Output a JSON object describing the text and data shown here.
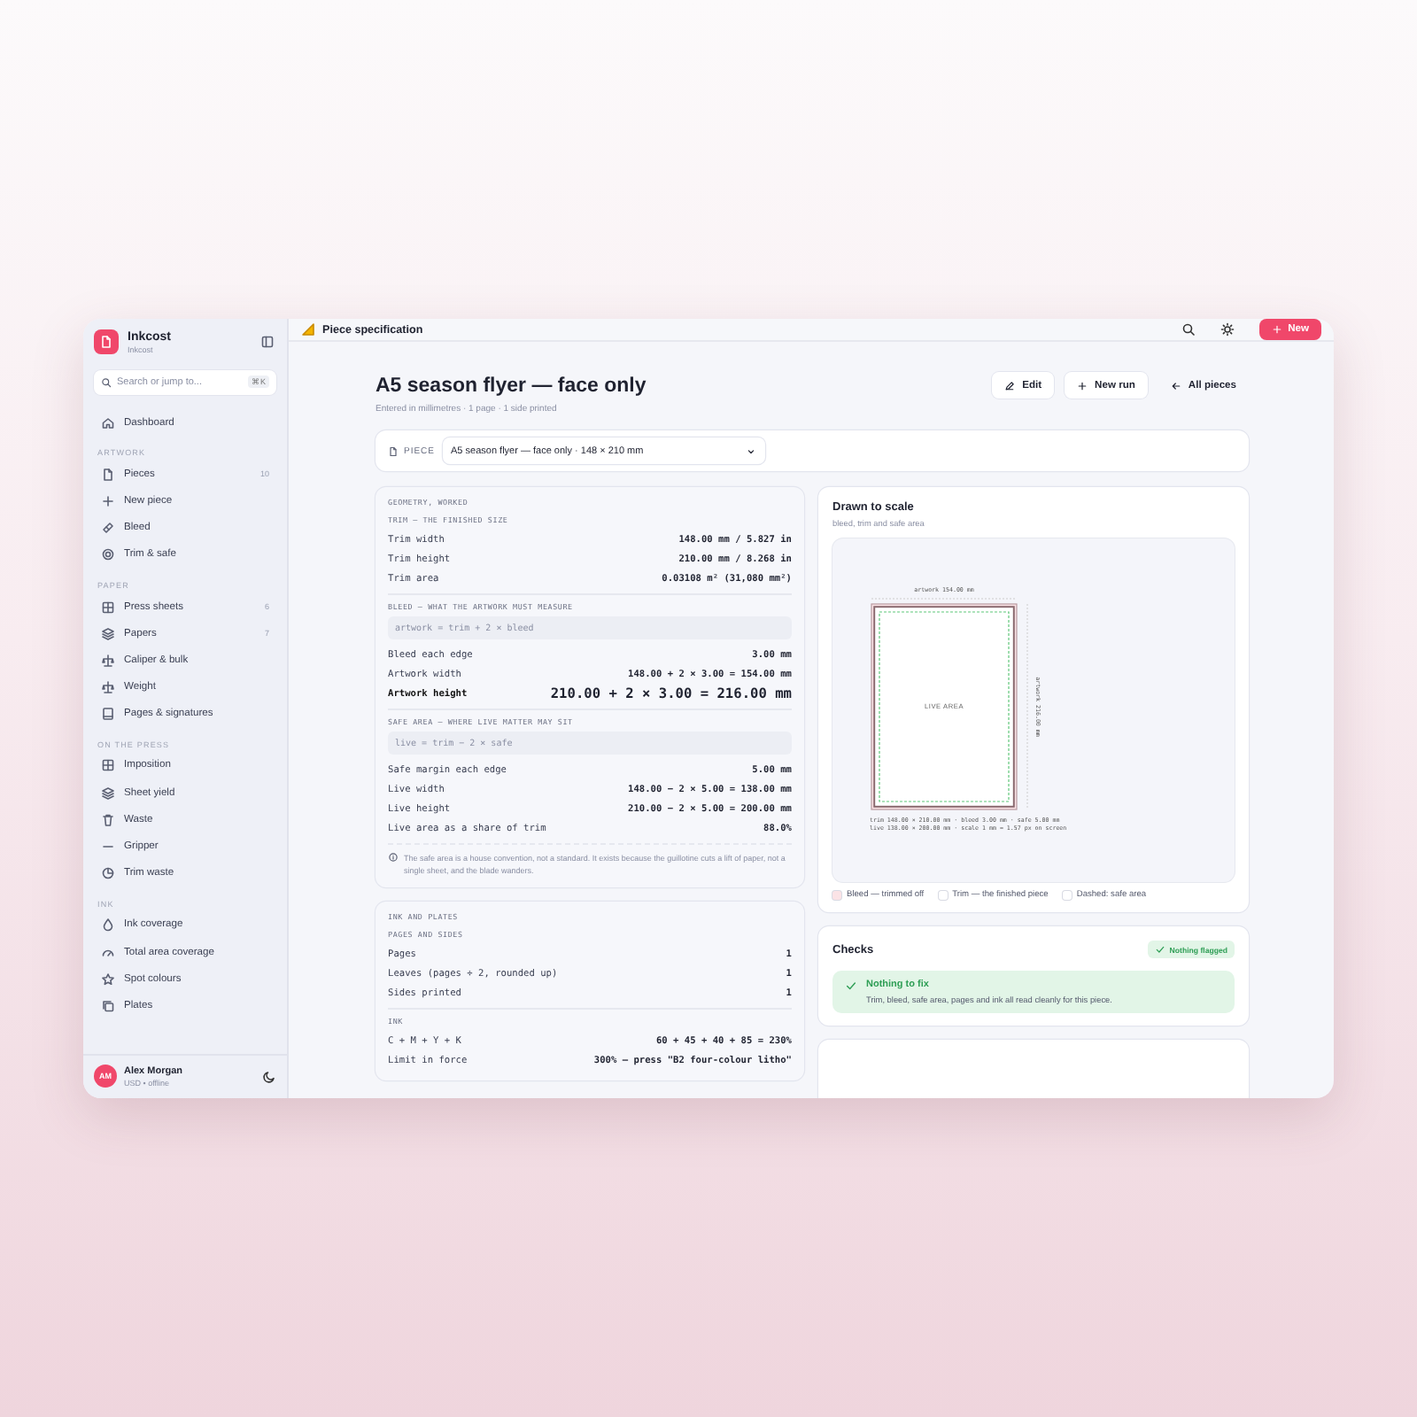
{
  "app": {
    "name": "Inkcost",
    "subtitle": "Inkcost"
  },
  "search": {
    "placeholder": "Search or jump to...",
    "shortcut": "⌘K"
  },
  "sidebar": {
    "top_items": [
      {
        "label": "Dashboard"
      }
    ],
    "sections": [
      {
        "title": "ARTWORK",
        "items": [
          {
            "label": "Pieces",
            "count": "10"
          },
          {
            "label": "New piece"
          },
          {
            "label": "Bleed"
          },
          {
            "label": "Trim & safe"
          }
        ]
      },
      {
        "title": "PAPER",
        "items": [
          {
            "label": "Press sheets",
            "count": "6"
          },
          {
            "label": "Papers",
            "count": "7"
          },
          {
            "label": "Caliper & bulk"
          },
          {
            "label": "Weight"
          },
          {
            "label": "Pages & signatures"
          }
        ]
      },
      {
        "title": "ON THE PRESS",
        "items": [
          {
            "label": "Imposition"
          },
          {
            "label": "Sheet yield"
          },
          {
            "label": "Waste"
          },
          {
            "label": "Gripper"
          },
          {
            "label": "Trim waste"
          }
        ]
      },
      {
        "title": "INK",
        "items": [
          {
            "label": "Ink coverage"
          },
          {
            "label": "Total area coverage"
          },
          {
            "label": "Spot colours"
          },
          {
            "label": "Plates"
          }
        ]
      }
    ]
  },
  "user": {
    "initials": "AM",
    "name": "Alex Morgan",
    "status": "USD • offline"
  },
  "topbar": {
    "title": "Piece specification",
    "new_button": "New"
  },
  "page": {
    "title": "A5 season flyer — face only",
    "subtitle": "Entered in millimetres · 1 page · 1 side printed",
    "actions": [
      "Edit",
      "New run",
      "All pieces"
    ]
  },
  "piece_selector": {
    "label": "PIECE",
    "value": "A5 season flyer — face only · 148 × 210 mm"
  },
  "geometry": {
    "heading": "GEOMETRY, WORKED",
    "sections": [
      {
        "title": "TRIM — THE FINISHED SIZE",
        "rows": [
          {
            "label": "Trim width",
            "value": "148.00 mm / 5.827 in",
            "emphasis": false
          },
          {
            "label": "Trim height",
            "value": "210.00 mm / 8.268 in",
            "emphasis": false
          },
          {
            "label": "Trim area",
            "value": "0.03108 m² (31,080 mm²)",
            "emphasis": false
          }
        ]
      },
      {
        "title": "BLEED — WHAT THE ARTWORK MUST MEASURE",
        "formula": "artwork = trim + 2 × bleed",
        "rows": [
          {
            "label": "Bleed each edge",
            "value": "3.00 mm",
            "emphasis": false
          },
          {
            "label": "Artwork width",
            "value": "148.00 + 2 × 3.00 = 154.00 mm",
            "emphasis": false
          },
          {
            "label": "Artwork height",
            "value": "210.00 + 2 × 3.00 = 216.00 mm",
            "emphasis": true
          }
        ]
      },
      {
        "title": "SAFE AREA — WHERE LIVE MATTER MAY SIT",
        "formula": "live = trim − 2 × safe",
        "rows": [
          {
            "label": "Safe margin each edge",
            "value": "5.00 mm",
            "emphasis": false
          },
          {
            "label": "Live width",
            "value": "148.00 − 2 × 5.00 = 138.00 mm",
            "emphasis": false
          },
          {
            "label": "Live height",
            "value": "210.00 − 2 × 5.00 = 200.00 mm",
            "emphasis": false
          },
          {
            "label": "Live area as a share of trim",
            "value": "88.0%",
            "emphasis": false
          }
        ]
      }
    ],
    "note": "The safe area is a house convention, not a standard. It exists because the guillotine cuts a lift of paper, not a single sheet, and the blade wanders."
  },
  "ink": {
    "heading": "INK AND PLATES",
    "sections": [
      {
        "title": "PAGES AND SIDES",
        "rows": [
          {
            "label": "Pages",
            "value": "1",
            "emphasis": false
          },
          {
            "label": "Leaves (pages ÷ 2, rounded up)",
            "value": "1",
            "emphasis": false
          },
          {
            "label": "Sides printed",
            "value": "1",
            "emphasis": false
          }
        ]
      },
      {
        "title": "INK",
        "rows": [
          {
            "label": "C + M + Y + K",
            "value": "60 + 45 + 40 + 85 = 230%",
            "emphasis": false
          },
          {
            "label": "Limit in force",
            "value": "300% — press \"B2 four-colour litho\"",
            "emphasis": false
          }
        ]
      }
    ]
  },
  "drawing": {
    "title": "Drawn to scale",
    "subtitle": "bleed, trim and safe area",
    "width_label": "artwork 154.00 mm",
    "height_label": "artwork 216.00 mm",
    "centre_label": "LIVE AREA",
    "footnotes": [
      "trim 148.00 × 210.00 mm · bleed 3.00 mm · safe 5.00 mm",
      "live 138.00 × 200.00 mm · scale 1 mm = 1.57 px on screen"
    ],
    "legend": [
      {
        "label": "Bleed — trimmed off",
        "color": "#fbe3e6"
      },
      {
        "label": "Trim — the finished piece",
        "color": "#ffffff"
      },
      {
        "label": "Dashed: safe area",
        "color": "#ffffff"
      }
    ]
  },
  "checks": {
    "title": "Checks",
    "badge": "Nothing flagged",
    "alert_title": "Nothing to fix",
    "alert_text": "Trim, bleed, safe area, pages and ink all read cleanly for this piece."
  }
}
